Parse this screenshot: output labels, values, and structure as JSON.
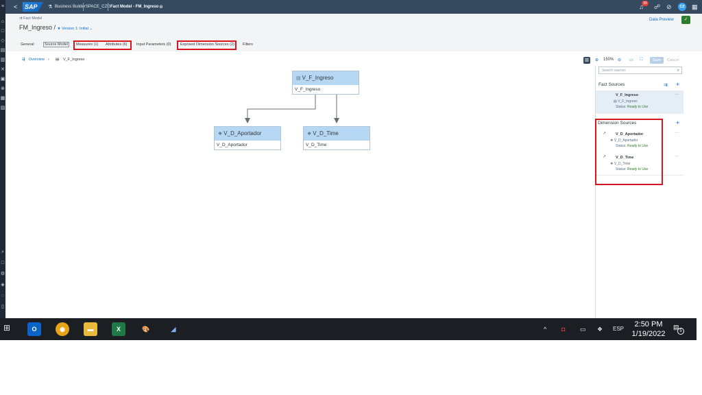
{
  "shell": {
    "back": "<",
    "logo": "SAP",
    "app_name": "Business Builder",
    "space": "SPACE_CZG",
    "doc_title": "Fact Model - FM_Ingreso",
    "notifications_count": "99",
    "user_initials": "CZ"
  },
  "header": {
    "object_type": "Fact Model",
    "model_name": "FM_Ingreso",
    "separator": " / ",
    "version": "Version 1: Initial",
    "data_preview": "Data Preview"
  },
  "tabs": [
    {
      "label": "General"
    },
    {
      "label": "Source Model"
    },
    {
      "label": "Measures (1)"
    },
    {
      "label": "Attributes (6)"
    },
    {
      "label": "Input Parameters (0)"
    },
    {
      "label": "Exposed Dimension Sources (2)"
    },
    {
      "label": "Filters"
    }
  ],
  "breadcrumb": {
    "overview": "Overview",
    "current": "V_F_Ingreso"
  },
  "toolbar": {
    "zoom": "150%",
    "save": "Save",
    "cancel": "Cancel"
  },
  "canvas": {
    "fact_node": {
      "title": "V_F_Ingreso",
      "body": "V_F_Ingreso"
    },
    "dim_nodes": [
      {
        "title": "V_D_Aportador",
        "body": "V_D_Aportador"
      },
      {
        "title": "V_D_Time",
        "body": "V_D_Time"
      }
    ]
  },
  "panel": {
    "search_placeholder": "Search sources",
    "fact_sources_title": "Fact Sources",
    "fact_sources": [
      {
        "name": "V_F_Ingreso",
        "sub": "V_F_Ingreso",
        "status_label": "Status: ",
        "status_value": "Ready to Use"
      }
    ],
    "dimension_sources_title": "Dimension Sources",
    "dimension_sources": [
      {
        "name": "V_D_Aportador",
        "sub": "V_D_Aportador",
        "status_label": "Status: ",
        "status_value": "Ready to Use"
      },
      {
        "name": "V_D_Time",
        "sub": "V_D_Time",
        "status_label": "Status: ",
        "status_value": "Ready to Use"
      }
    ]
  },
  "taskbar": {
    "apps": [
      "Outlook",
      "Chrome",
      "File Explorer",
      "Excel",
      "Paint",
      "Notes"
    ],
    "language": "ESP",
    "time": "2:50 PM",
    "date": "1/19/2022",
    "notification_count": "5"
  },
  "colors": {
    "shell": "#354a5f",
    "accent": "#0a6ed1",
    "node_header": "#b6d7f4",
    "highlight": "#d6151f",
    "status_ok": "#2b7d2b"
  }
}
